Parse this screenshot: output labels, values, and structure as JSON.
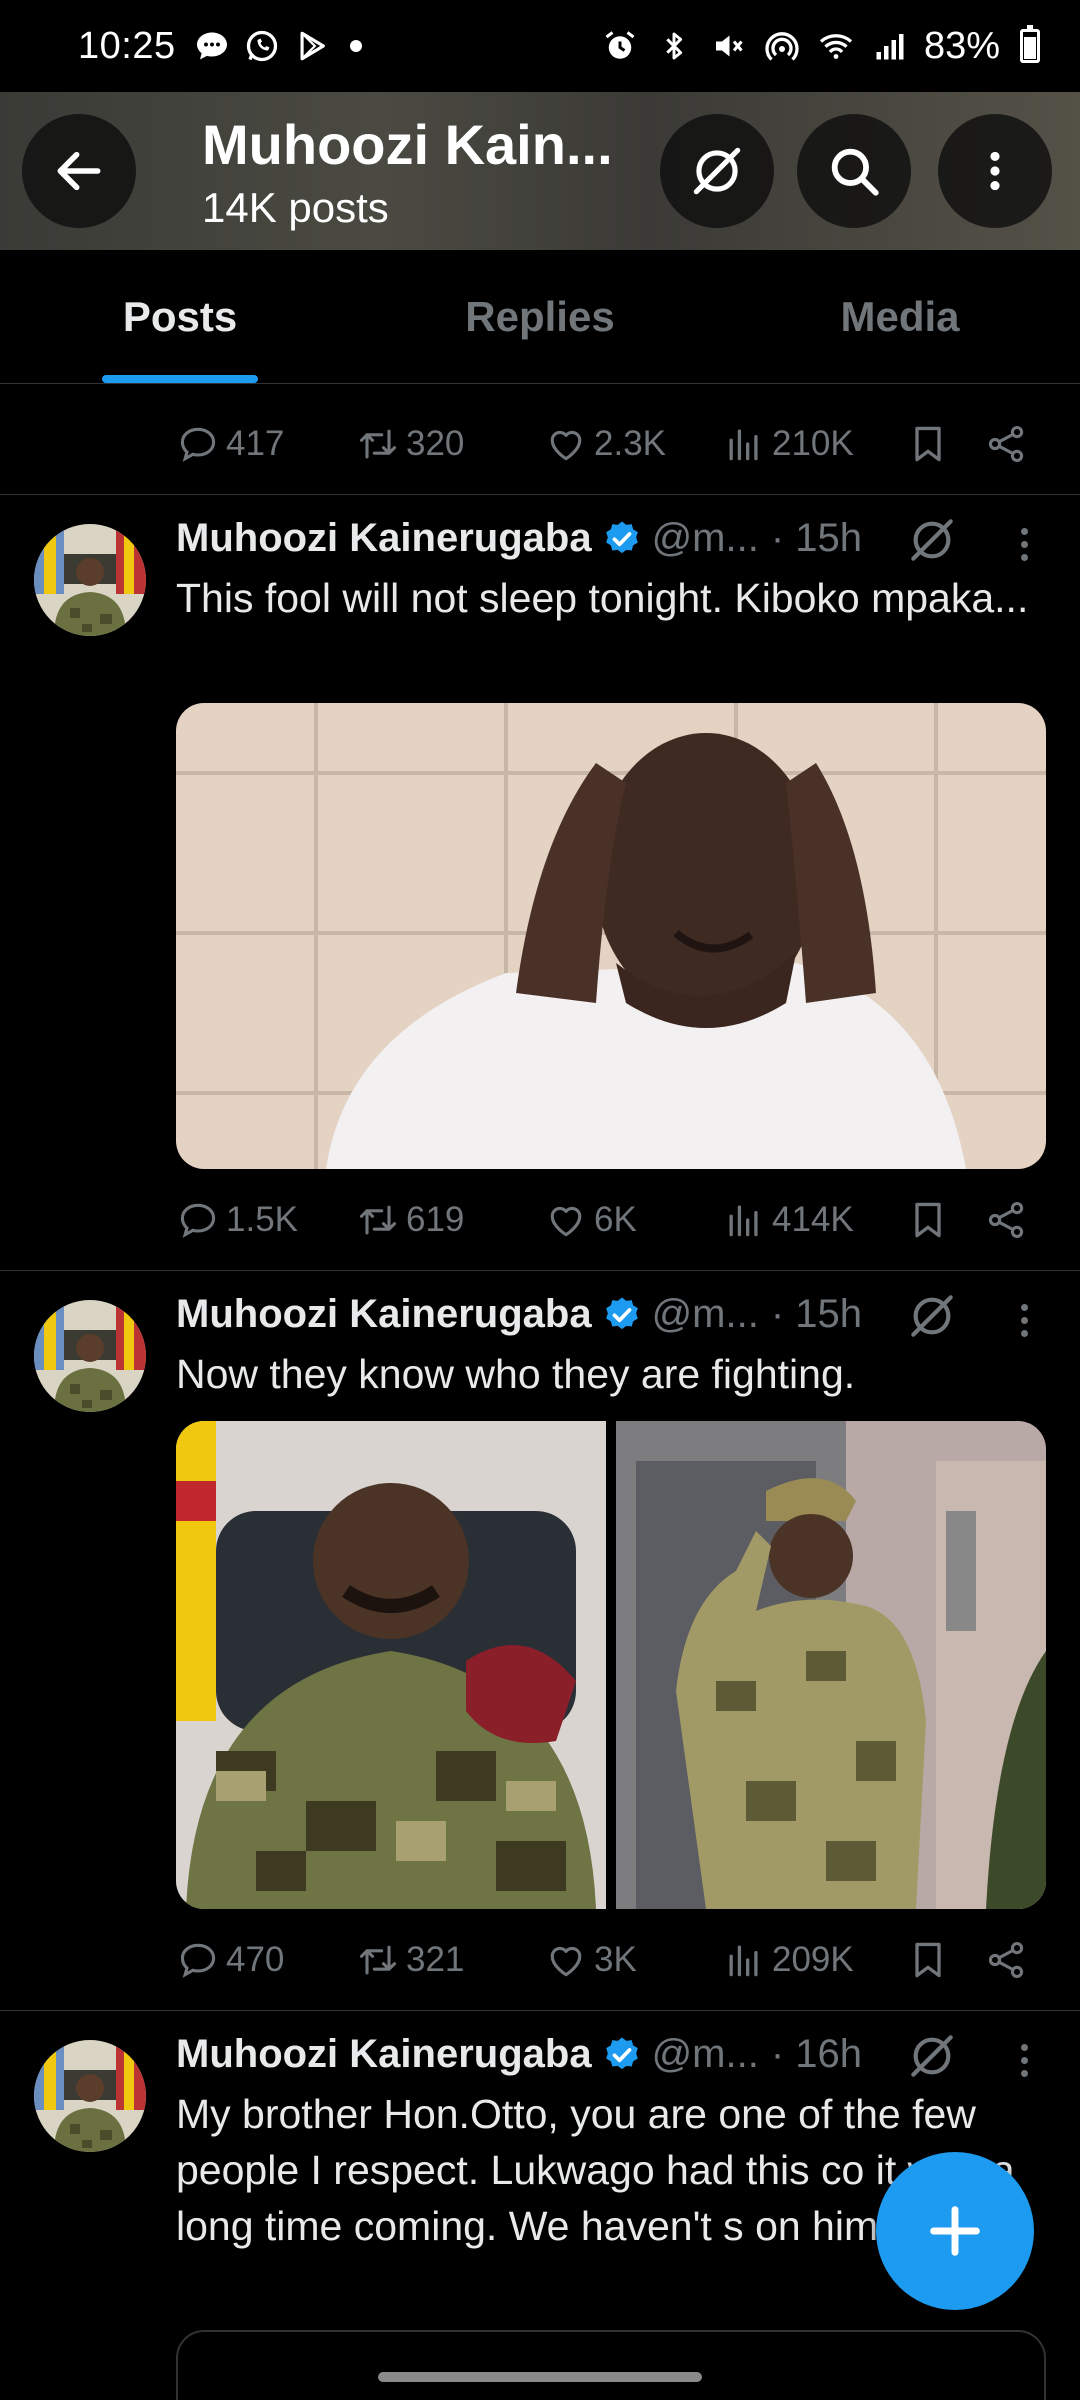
{
  "status_bar": {
    "time": "10:25",
    "battery": "83%",
    "left_icons": [
      "chat-icon",
      "whatsapp-icon",
      "play-store-icon"
    ],
    "right_icons": [
      "alarm-icon",
      "bluetooth-icon",
      "mute-icon",
      "hotspot-icon",
      "wifi-icon",
      "signal-icon",
      "battery-icon"
    ]
  },
  "header": {
    "title": "Muhoozi Kain...",
    "subtitle": "14K posts"
  },
  "tabs": [
    {
      "label": "Posts",
      "active": true
    },
    {
      "label": "Replies",
      "active": false
    },
    {
      "label": "Media",
      "active": false
    }
  ],
  "top_actions": {
    "replies": "417",
    "retweets": "320",
    "likes": "2.3K",
    "views": "210K"
  },
  "posts": [
    {
      "name": "Muhoozi Kainerugaba",
      "handle": "@m...",
      "time": "· 15h",
      "text": "This fool will not sleep tonight. Kiboko mpaka...",
      "actions": {
        "replies": "1.5K",
        "retweets": "619",
        "likes": "6K",
        "views": "414K"
      }
    },
    {
      "name": "Muhoozi Kainerugaba",
      "handle": "@m...",
      "time": "· 15h",
      "text": "Now they know who they are fighting.",
      "actions": {
        "replies": "470",
        "retweets": "321",
        "likes": "3K",
        "views": "209K"
      }
    },
    {
      "name": "Muhoozi Kainerugaba",
      "handle": "@m...",
      "time": "· 16h",
      "text": "My brother Hon.Otto, you are one of the few people I respect. Lukwago had this co it was a long time coming. We haven't s on him yet."
    }
  ],
  "colors": {
    "accent": "#1d9bf0",
    "muted": "#71767b",
    "background": "#000000",
    "text": "#e7e9ea"
  }
}
